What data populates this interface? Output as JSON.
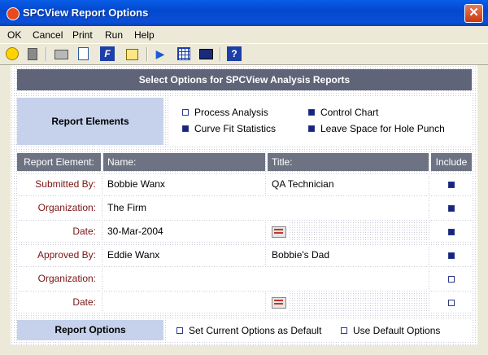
{
  "window": {
    "title": "SPCView Report Options",
    "close_symbol": "✕"
  },
  "menu": [
    "OK",
    "Cancel",
    "Print",
    "Run",
    "Help"
  ],
  "toolbar": [
    "smiley-icon",
    "trash-icon",
    "print-icon",
    "preview-icon",
    "font-icon",
    "edit-icon",
    "run-icon",
    "grid-icon",
    "window-icon",
    "help-icon"
  ],
  "header": "Select Options for SPCView Analysis Reports",
  "report_elements": {
    "label": "Report Elements",
    "options": [
      {
        "label": "Process Analysis",
        "checked": false
      },
      {
        "label": "Control Chart",
        "checked": true
      },
      {
        "label": "Curve Fit Statistics",
        "checked": true
      },
      {
        "label": "Leave Space for Hole Punch",
        "checked": true
      }
    ]
  },
  "table": {
    "columns": [
      "Report Element:",
      "Name:",
      "Title:",
      "Include"
    ],
    "rows": [
      {
        "label": "Submitted By:",
        "name": "Bobbie Wanx",
        "title": "QA Technician",
        "include": true
      },
      {
        "label": "Organization:",
        "name": "The Firm",
        "include": true
      },
      {
        "label": "Date:",
        "name": "30-Mar-2004",
        "include": true
      },
      {
        "label": "Approved By:",
        "name": "Eddie Wanx",
        "title": "Bobbie's Dad",
        "include": true
      },
      {
        "label": "Organization:",
        "name": "",
        "include": false
      },
      {
        "label": "Date:",
        "name": "",
        "include": false
      }
    ]
  },
  "report_options": {
    "label": "Report Options",
    "options": [
      {
        "label": "Set Current Options as Default",
        "checked": false
      },
      {
        "label": "Use Default Options",
        "checked": false
      }
    ]
  },
  "colors": {
    "title_bar": "#0348cd",
    "header_bar": "#5f6478",
    "section_bg": "#c6d2ec",
    "row_label": "#7a1414",
    "checked": "#1a237e"
  }
}
